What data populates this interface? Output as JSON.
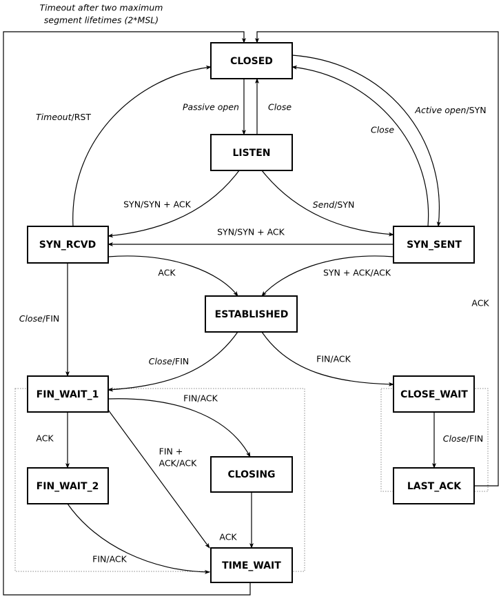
{
  "states": {
    "closed": "CLOSED",
    "listen": "LISTEN",
    "syn_rcvd": "SYN_RCVD",
    "syn_sent": "SYN_SENT",
    "established": "ESTABLISHED",
    "fin_wait_1": "FIN_WAIT_1",
    "fin_wait_2": "FIN_WAIT_2",
    "closing": "CLOSING",
    "time_wait": "TIME_WAIT",
    "close_wait": "CLOSE_WAIT",
    "last_ack": "LAST_ACK"
  },
  "transitions": {
    "time_wait_closed": {
      "line1": "Timeout after two maximum",
      "line2": "segment lifetimes (2*MSL)"
    },
    "closed_listen": {
      "italic": "Passive open"
    },
    "listen_closed": {
      "italic": "Close"
    },
    "syn_rcvd_closed": {
      "italic": "Timeout",
      "plain": "/RST"
    },
    "closed_syn_sent": {
      "italic": "Active open",
      "plain": "/SYN"
    },
    "syn_sent_closed": {
      "italic": "Close"
    },
    "listen_syn_rcvd": {
      "plain": "SYN/SYN + ACK"
    },
    "listen_syn_sent": {
      "italic": "Send",
      "plain": "/SYN"
    },
    "syn_sent_syn_rcvd": {
      "plain": "SYN/SYN + ACK"
    },
    "syn_rcvd_established": {
      "plain": "ACK"
    },
    "syn_sent_established": {
      "plain": "SYN + ACK/ACK"
    },
    "syn_rcvd_fin_wait_1": {
      "italic": "Close",
      "plain": "/FIN"
    },
    "established_fin_wait_1": {
      "italic": "Close",
      "plain": "/FIN"
    },
    "established_close_wait": {
      "plain": "FIN/ACK"
    },
    "close_wait_last_ack": {
      "italic": "Close",
      "plain": "/FIN"
    },
    "last_ack_closed": {
      "plain": "ACK"
    },
    "fin_wait_1_fin_wait_2": {
      "plain": "ACK"
    },
    "fin_wait_1_time_wait": {
      "line1": "FIN +",
      "line2": "ACK/ACK"
    },
    "fin_wait_1_closing": {
      "plain": "FIN/ACK"
    },
    "closing_time_wait": {
      "plain": "ACK"
    },
    "fin_wait_2_time_wait": {
      "plain": "FIN/ACK"
    }
  }
}
